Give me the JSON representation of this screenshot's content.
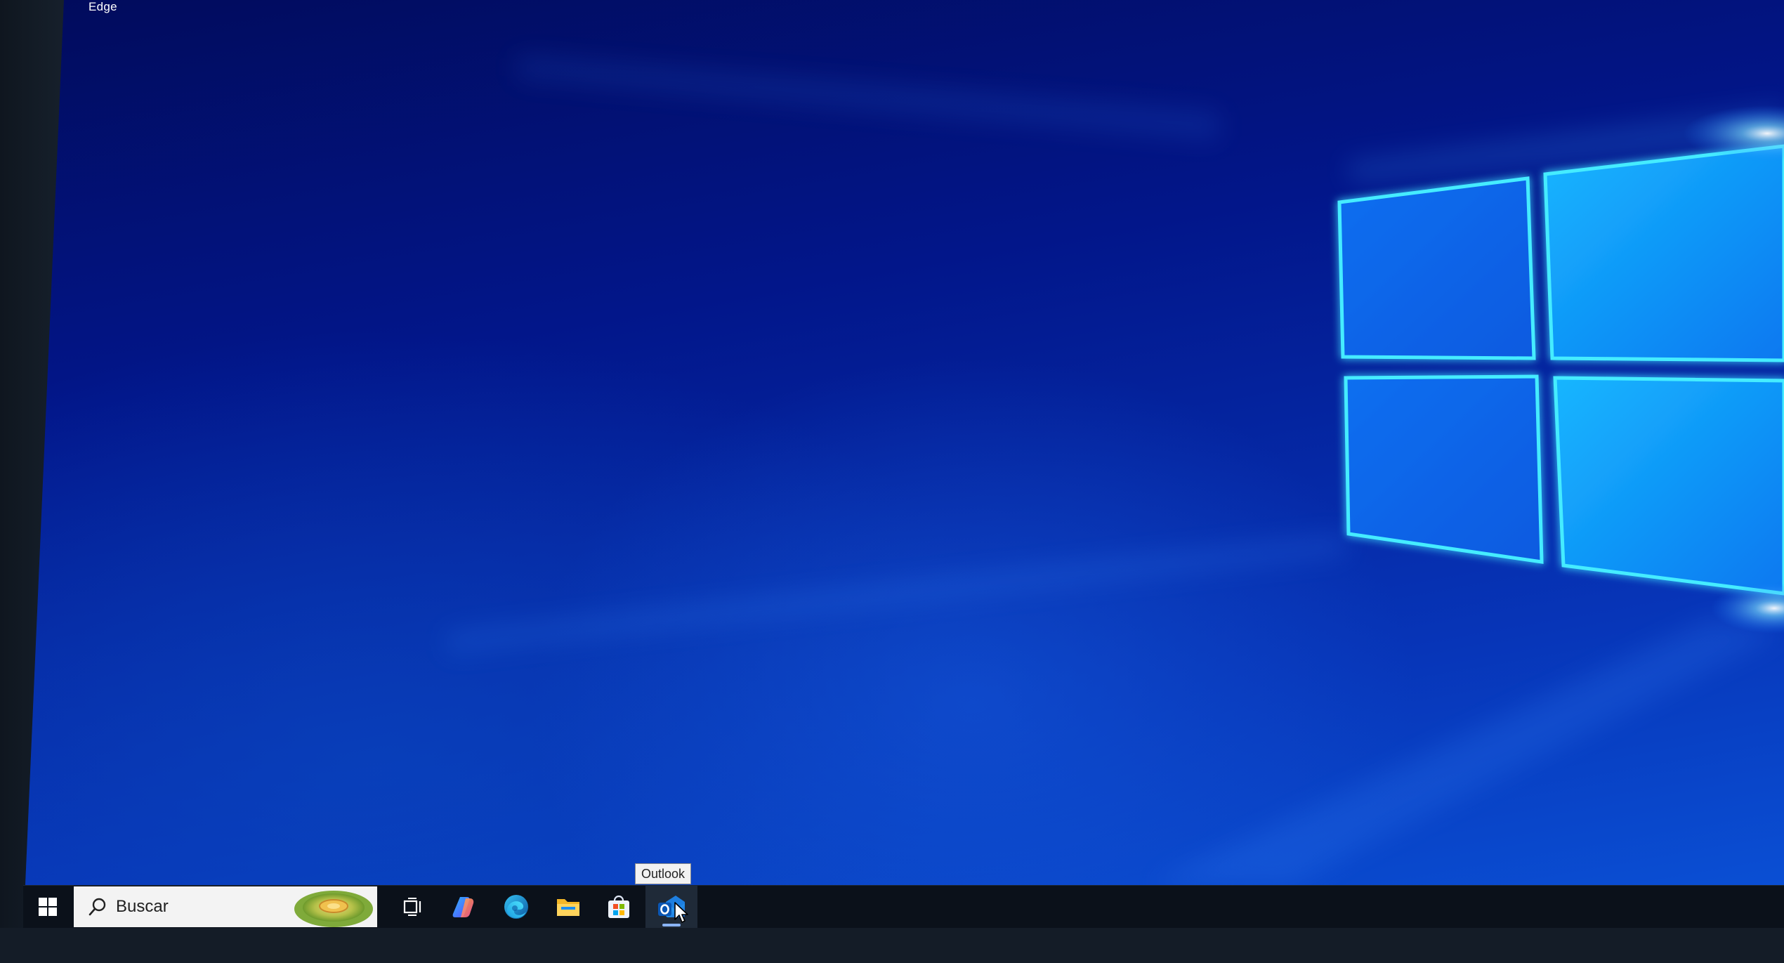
{
  "desktop": {
    "top_label": "Edge",
    "wallpaper": "windows-10-hero-blue",
    "colors": {
      "wallpaper_dark": "#010b5c",
      "wallpaper_mid": "#0735b8",
      "logo_glow": "#37e6ff"
    }
  },
  "taskbar": {
    "search": {
      "placeholder": "Buscar"
    },
    "pinned_apps": [
      {
        "name": "Task View",
        "icon": "task-view-icon"
      },
      {
        "name": "Copilot",
        "icon": "copilot-icon"
      },
      {
        "name": "Microsoft Edge",
        "icon": "edge-icon"
      },
      {
        "name": "File Explorer",
        "icon": "folder-icon"
      },
      {
        "name": "Microsoft Store",
        "icon": "store-icon"
      },
      {
        "name": "Outlook",
        "icon": "outlook-icon",
        "hovered": true
      }
    ],
    "colors": {
      "background": "#0b111a",
      "hover": "#1f2a38"
    }
  },
  "tooltip": {
    "text": "Outlook"
  }
}
